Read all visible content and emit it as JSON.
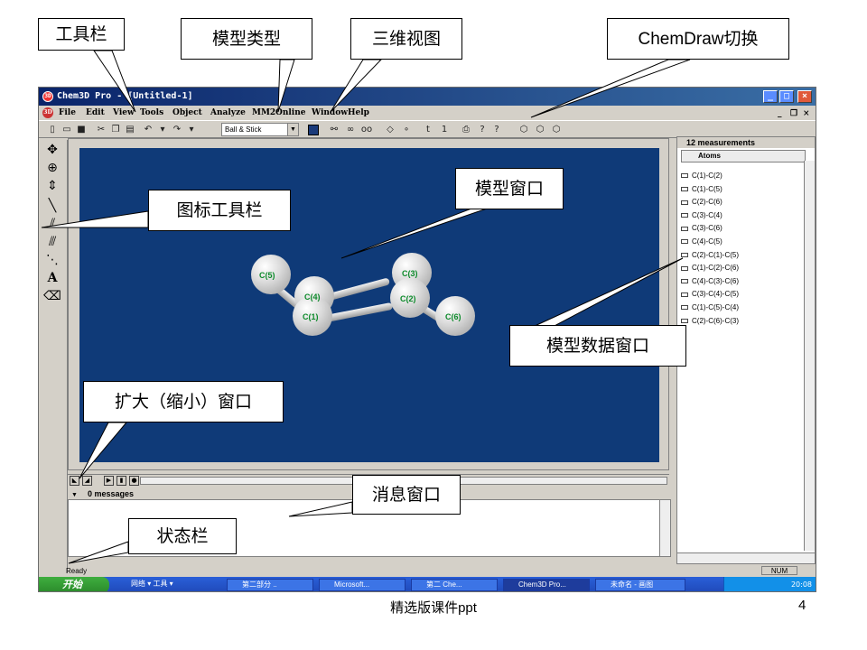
{
  "window": {
    "title": "Chem3D Pro - [Untitled-1]",
    "app_icon": "3D"
  },
  "menu": [
    "File",
    "Edit",
    "View",
    "Tools",
    "Object",
    "Analyze",
    "MM2",
    "Online",
    "Window",
    "Help"
  ],
  "toolbar": {
    "model_type": "Ball & Stick",
    "model_color": "#1a3a7a"
  },
  "atoms": [
    {
      "label": "C(5)"
    },
    {
      "label": "C(4)"
    },
    {
      "label": "C(1)"
    },
    {
      "label": "C(3)"
    },
    {
      "label": "C(2)"
    },
    {
      "label": "C(6)"
    }
  ],
  "measurements": {
    "header": "12 measurements",
    "column": "Atoms",
    "items": [
      "C(1)-C(2)",
      "C(1)-C(5)",
      "C(2)-C(6)",
      "C(3)-C(4)",
      "C(3)-C(6)",
      "C(4)-C(5)",
      "C(2)-C(1)-C(5)",
      "C(1)-C(2)-C(6)",
      "C(4)-C(3)-C(6)",
      "C(3)-C(4)-C(5)",
      "C(1)-C(5)-C(4)",
      "C(2)-C(6)-C(3)"
    ]
  },
  "messages": {
    "header": "0 messages"
  },
  "status": {
    "text": "Ready",
    "num": "NUM"
  },
  "taskbar": {
    "start": "开始",
    "items": [
      "网络 ▾ 工具 ▾",
      "第二部分 ..",
      "Microsoft...",
      "第二  Che...",
      "Chem3D Pro...",
      "未命名 - 画图"
    ],
    "clock": "20:08"
  },
  "callouts": {
    "toolbar": "工具栏",
    "model_type": "模型类型",
    "view_3d": "三维视图",
    "chemdraw_switch": "ChemDraw切换",
    "icon_toolbar": "图标工具栏",
    "model_window": "模型窗口",
    "model_data_window": "模型数据窗口",
    "zoom_window": "扩大（缩小）窗口",
    "message_window": "消息窗口",
    "status_bar": "状态栏"
  },
  "footer": {
    "caption": "精选版课件ppt",
    "page": "4"
  }
}
